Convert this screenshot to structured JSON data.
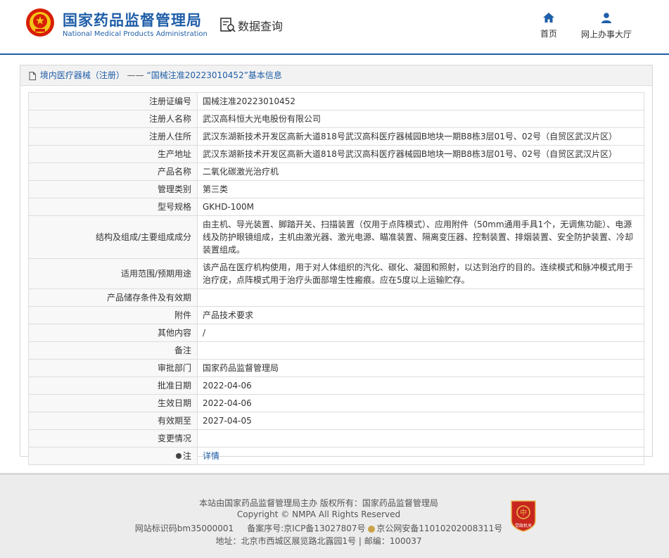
{
  "header": {
    "logo_cn": "国家药品监督管理局",
    "logo_en": "National Medical Products Administration",
    "data_query": "数据查询",
    "nav": {
      "home": "首页",
      "office": "网上办事大厅"
    }
  },
  "breadcrumb": {
    "category": "境内医疗器械（注册）",
    "separator": "——",
    "title": "“国械注准20223010452”基本信息"
  },
  "fields": [
    {
      "key": "注册证编号",
      "value": "国械注准20223010452"
    },
    {
      "key": "注册人名称",
      "value": "武汉高科恒大光电股份有限公司"
    },
    {
      "key": "注册人住所",
      "value": "武汉东湖新技术开发区高新大道818号武汉高科医疗器械园B地块一期B8栋3层01号、02号（自贸区武汉片区）"
    },
    {
      "key": "生产地址",
      "value": "武汉东湖新技术开发区高新大道818号武汉高科医疗器械园B地块一期B8栋3层01号、02号（自贸区武汉片区）"
    },
    {
      "key": "产品名称",
      "value": "二氧化碳激光治疗机"
    },
    {
      "key": "管理类别",
      "value": "第三类"
    },
    {
      "key": "型号规格",
      "value": "GKHD-100M"
    },
    {
      "key": "结构及组成/主要组成成分",
      "value": "由主机、导光装置、脚踏开关、扫描装置（仅用于点阵模式）、应用附件（50mm通用手具1个，无调焦功能）、电源线及防护眼镜组成，主机由激光器、激光电源、瞄准装置、隔离变压器、控制装置、排烟装置、安全防护装置、冷却装置组成。"
    },
    {
      "key": "适用范围/预期用途",
      "value": "该产品在医疗机构使用，用于对人体组织的汽化、碳化、凝固和照射，以达到治疗的目的。连续模式和脉冲模式用于治疗疣，点阵模式用于治疗头面部增生性瘢痕。应在5度以上运输贮存。"
    },
    {
      "key": "产品储存条件及有效期",
      "value": ""
    },
    {
      "key": "附件",
      "value": "产品技术要求"
    },
    {
      "key": "其他内容",
      "value": "/"
    },
    {
      "key": "备注",
      "value": ""
    },
    {
      "key": "审批部门",
      "value": "国家药品监督管理局"
    },
    {
      "key": "批准日期",
      "value": "2022-04-06"
    },
    {
      "key": "生效日期",
      "value": "2022-04-06"
    },
    {
      "key": "有效期至",
      "value": "2027-04-05"
    },
    {
      "key": "变更情况",
      "value": ""
    }
  ],
  "note": {
    "key": "注",
    "link": "详情"
  },
  "footer": {
    "line1": "本站由国家药品监督管理局主办 版权所有：国家药品监督管理局",
    "line2": "Copyright © NMPA All Rights Reserved",
    "site_id": "网站标识码bm35000001",
    "icp": "备案序号:京ICP备13027807号",
    "police": "京公网安备11010202008311号",
    "address": "地址：北京市西城区展览路北露园1号 | 邮编：100037",
    "badge_text": "党政机关"
  },
  "colors": {
    "brand_blue": "#1f5ea8",
    "emblem_red": "#d81e06",
    "emblem_gold": "#f5c518"
  }
}
